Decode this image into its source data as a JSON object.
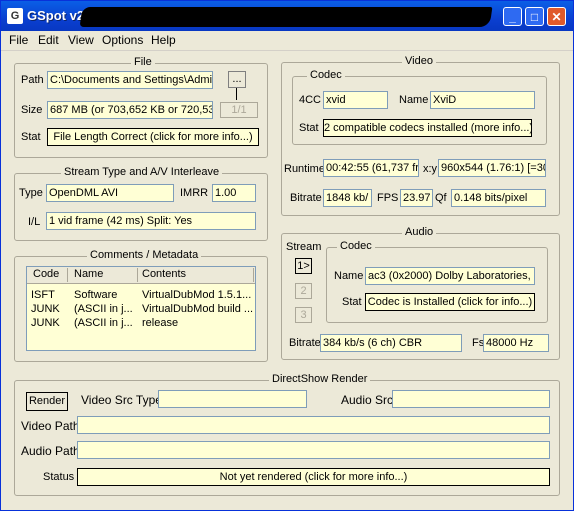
{
  "window": {
    "title": "GSpot v2.2",
    "icon": "gspot-app-icon"
  },
  "titlebar": {
    "minimize": "_",
    "maximize": "□",
    "close": "✕"
  },
  "menu": [
    "File",
    "Edit",
    "View",
    "Options",
    "Help"
  ],
  "file": {
    "title": "File",
    "path_label": "Path",
    "path_value": "C:\\Documents and Settings\\Admi",
    "browse_label": "...",
    "size_label": "Size",
    "size_value": "687 MB (or 703,652 KB or 720,53",
    "page_label": "1/1",
    "stat_label": "Stat",
    "stat_value": "File Length Correct (click for more info...)"
  },
  "stream": {
    "title": "Stream Type and A/V Interleave",
    "type_label": "Type",
    "type_value": "OpenDML AVI",
    "imrr_label": "IMRR",
    "imrr_value": "1.00",
    "il_label": "I/L",
    "il_value": "1 vid frame (42 ms)  Split: Yes"
  },
  "comments": {
    "title": "Comments / Metadata",
    "columns": [
      "Code",
      "Name",
      "Contents"
    ],
    "rows": [
      [
        "ISFT",
        "Software",
        "VirtualDubMod 1.5.1..."
      ],
      [
        "JUNK",
        "(ASCII in j...",
        "VirtualDubMod build ..."
      ],
      [
        "JUNK",
        "(ASCII in j...",
        "release"
      ]
    ]
  },
  "video": {
    "title": "Video",
    "codec_title": "Codec",
    "fourcc_label": "4CC",
    "fourcc_value": "xvid",
    "name_label": "Name",
    "name_value": "XviD",
    "stat_label": "Stat",
    "stat_value": "2 compatible codecs installed (more info...)",
    "runtime_label": "Runtime",
    "runtime_value": "00:42:55 (61,737 fr",
    "xy_label": "x:y",
    "xy_value": "960x544 (1.76:1) [=30",
    "bitrate_label": "Bitrate",
    "bitrate_value": "1848 kb/",
    "fps_label": "FPS",
    "fps_value": "23.97",
    "qf_label": "Qf",
    "qf_value": "0.148 bits/pixel"
  },
  "audio": {
    "title": "Audio",
    "stream_label": "Stream",
    "codec_title": "Codec",
    "stream_buttons": [
      "1>",
      "2",
      "3"
    ],
    "name_label": "Name",
    "name_value": "ac3 (0x2000) Dolby Laboratories, I",
    "stat_label": "Stat",
    "stat_value": "Codec is Installed (click for info...)",
    "bitrate_label": "Bitrate",
    "bitrate_value": "384 kb/s (6 ch) CBR",
    "fs_label": "Fs",
    "fs_value": "48000 Hz"
  },
  "render": {
    "title": "DirectShow Render",
    "render_button": "Render",
    "video_src_type_label": "Video Src Type",
    "video_src_type_value": "",
    "audio_src_label": "Audio Src",
    "audio_src_value": "",
    "video_path_label": "Video Path",
    "video_path_value": "",
    "audio_path_label": "Audio Path",
    "audio_path_value": "",
    "status_label": "Status",
    "status_value": "Not yet rendered (click for more info...)"
  },
  "colors": {
    "field_bg": "#ffffd5",
    "window_bg": "#ece9d8",
    "titlebar": "#0a3fd0",
    "close_button": "#e05a2b"
  }
}
